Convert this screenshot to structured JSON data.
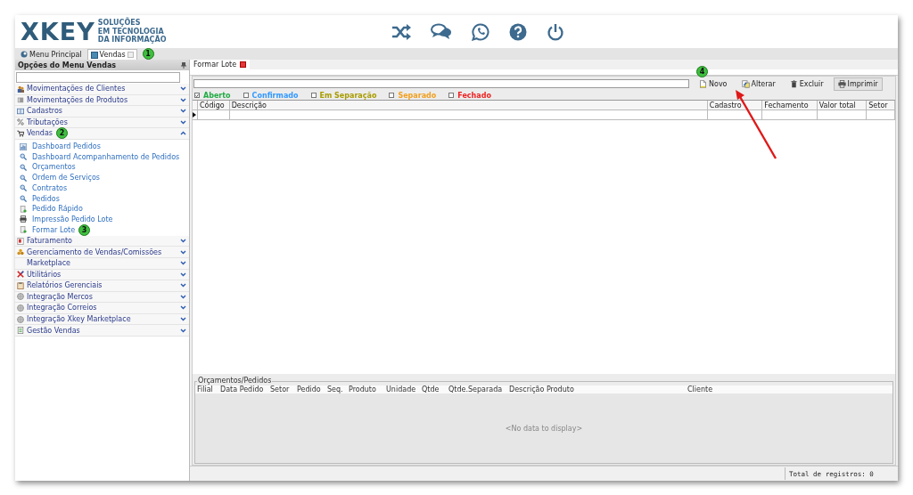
{
  "header": {
    "logo": "XKEY",
    "tagline": [
      "SOLUÇÕES",
      "EM TECNOLOGIA",
      "DA INFORMAÇÃO"
    ],
    "actions": [
      {
        "kind": "shuffle"
      },
      {
        "kind": "chat"
      },
      {
        "kind": "whatsapp"
      },
      {
        "kind": "help"
      },
      {
        "kind": "power"
      }
    ]
  },
  "main_tabs": [
    {
      "label": "Menu Principal",
      "selected": false,
      "closable": false
    },
    {
      "label": "Vendas",
      "selected": true,
      "closable": true,
      "badge": "1"
    }
  ],
  "sidebar": {
    "title": "Opções do Menu Vendas",
    "groups": [
      {
        "label": "Movimentações de Clientes",
        "kind": "people",
        "expanded": false
      },
      {
        "label": "Movimentações de Produtos",
        "kind": "box",
        "expanded": false
      },
      {
        "label": "Cadastros",
        "kind": "book",
        "expanded": false
      },
      {
        "label": "Tributações",
        "kind": "percent",
        "expanded": false
      },
      {
        "label": "Vendas",
        "kind": "cart",
        "expanded": true,
        "badge": "2",
        "children": [
          {
            "label": "Dashboard Pedidos",
            "kind": "chart"
          },
          {
            "label": "Dashboard Acompanhamento de Pedidos",
            "kind": "search"
          },
          {
            "label": "Orçamentos",
            "kind": "search"
          },
          {
            "label": "Ordem de Serviços",
            "kind": "search"
          },
          {
            "label": "Contratos",
            "kind": "search"
          },
          {
            "label": "Pedidos",
            "kind": "search"
          },
          {
            "label": "Pedido Rápido",
            "kind": "add"
          },
          {
            "label": "Impressão Pedido Lote",
            "kind": "print"
          },
          {
            "label": "Formar Lote",
            "kind": "add",
            "badge": "3"
          }
        ]
      },
      {
        "label": "Faturamento",
        "kind": "invoice",
        "expanded": false
      },
      {
        "label": "Gerenciamento de Vendas/Comissões",
        "kind": "coins",
        "expanded": false
      },
      {
        "label": "Marketplace",
        "kind": "none",
        "expanded": false
      },
      {
        "label": "Utilitários",
        "kind": "tools",
        "expanded": false
      },
      {
        "label": "Relatórios Gerenciais",
        "kind": "clipboard",
        "expanded": false
      },
      {
        "label": "Integração Mercos",
        "kind": "globe",
        "expanded": false
      },
      {
        "label": "Integração Correios",
        "kind": "globe",
        "expanded": false
      },
      {
        "label": "Integração Xkey Marketplace",
        "kind": "globe",
        "expanded": false
      },
      {
        "label": "Gestão Vendas",
        "kind": "sheet",
        "expanded": false
      }
    ]
  },
  "document_tab": {
    "label": "Formar Lote"
  },
  "toolbar": [
    {
      "label": "Novo",
      "kind": "new",
      "focused": false,
      "badge": "4"
    },
    {
      "label": "Alterar",
      "kind": "edit",
      "focused": false
    },
    {
      "label": "Excluir",
      "kind": "delete",
      "focused": false
    },
    {
      "label": "Imprimir",
      "kind": "print",
      "focused": true
    }
  ],
  "filters": [
    {
      "label": "Aberto",
      "checked": true,
      "color": "#22aa44"
    },
    {
      "label": "Confirmado",
      "checked": false,
      "color": "#3399ff"
    },
    {
      "label": "Em Separação",
      "checked": false,
      "color": "#a89c00"
    },
    {
      "label": "Separado",
      "checked": false,
      "color": "#f0a020"
    },
    {
      "label": "Fechado",
      "checked": false,
      "color": "#ee2222"
    }
  ],
  "grid": {
    "columns": [
      "Código",
      "Descrição",
      "Cadastro",
      "Fechamento",
      "Valor total",
      "Setor"
    ]
  },
  "detail": {
    "title": "Orçamentos/Pedidos",
    "columns": [
      "Filial",
      "Data Pedido",
      "Setor",
      "Pedido",
      "Seq.",
      "Produto",
      "Unidade",
      "Qtde",
      "Qtde.Separada",
      "Descrição Produto",
      "Cliente"
    ],
    "empty_text": "<No data to display>"
  },
  "status_bar": {
    "text": "Total de registros: 0"
  }
}
